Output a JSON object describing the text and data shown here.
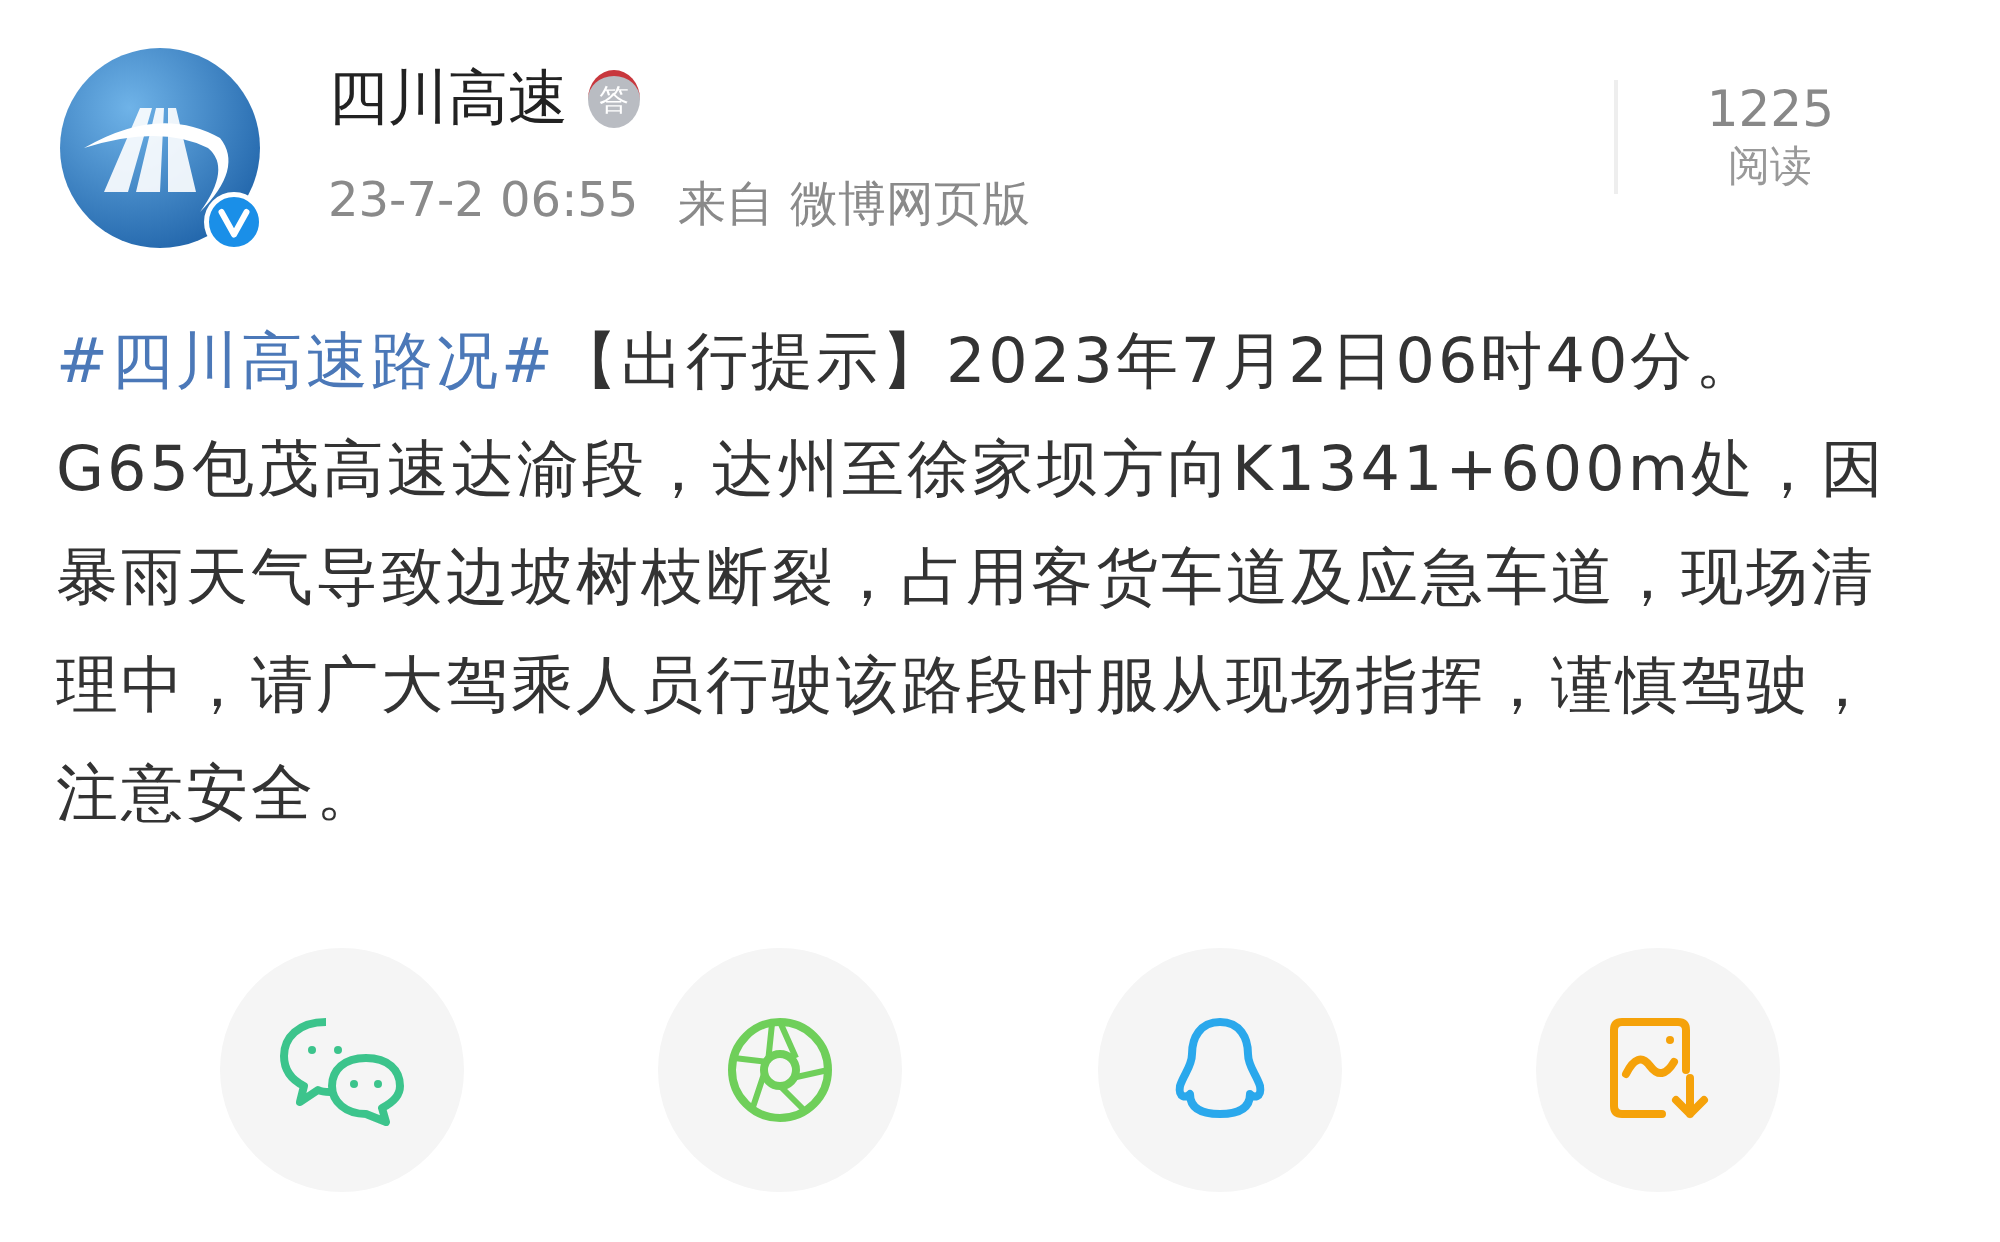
{
  "author": {
    "name": "四川高速",
    "badge": "答",
    "verified": true
  },
  "meta": {
    "time": "23-7-2 06:55",
    "source": "来自 微博网页版"
  },
  "stats": {
    "count": "1225",
    "label": "阅读"
  },
  "post": {
    "hashtag": "#四川高速路况#",
    "text": "【出行提示】2023年7月2日06时40分。G65包茂高速达渝段，达州至徐家坝方向K1341+600m处，因暴雨天气导致边坡树枝断裂，占用客货车道及应急车道，现场清理中，请广大驾乘人员行驶该路段时服从现场指挥，谨慎驾驶，注意安全。"
  },
  "share": [
    {
      "kind": "chat"
    },
    {
      "kind": "aperture"
    },
    {
      "kind": "penguin"
    },
    {
      "kind": "save-image"
    }
  ]
}
